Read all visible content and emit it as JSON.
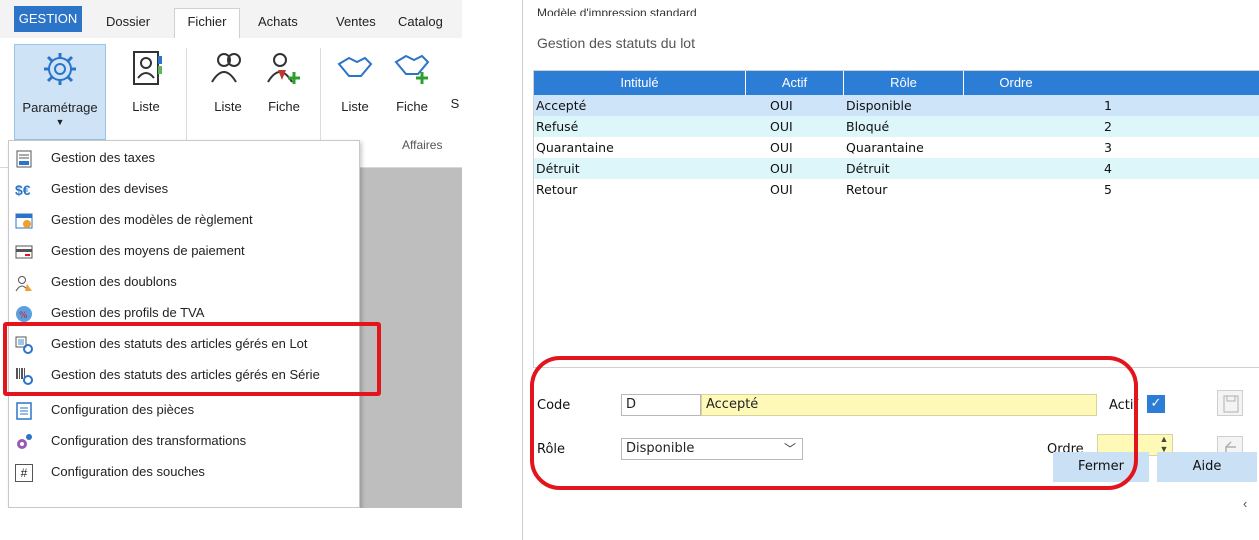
{
  "left": {
    "tabs": [
      "GESTION",
      "Dossier",
      "Fichier",
      "Achats",
      "Ventes",
      "Catalog"
    ],
    "ribbon": {
      "parametrage": "Paramétrage",
      "liste1": "Liste",
      "liste2": "Liste",
      "fiche1": "Fiche",
      "liste3": "Liste",
      "fiche2": "Fiche",
      "cut": "S",
      "group_affaires": "Affaires"
    },
    "menu": [
      {
        "label": "Gestion des taxes",
        "icon": "tax-doc-icon"
      },
      {
        "label": "Gestion des devises",
        "icon": "currency-icon"
      },
      {
        "label": "Gestion des modèles de règlement",
        "icon": "calendar-euro-icon"
      },
      {
        "label": "Gestion des moyens de paiement",
        "icon": "card-icon"
      },
      {
        "label": "Gestion des doublons",
        "icon": "duplicate-users-icon"
      },
      {
        "label": "Gestion des profils de TVA",
        "icon": "vat-globe-icon"
      },
      {
        "label": "Gestion des statuts des articles gérés en Lot",
        "icon": "lot-status-icon"
      },
      {
        "label": "Gestion des statuts des articles gérés en Série",
        "icon": "serial-status-icon"
      },
      {
        "label": "Configuration des pièces",
        "icon": "document-icon"
      },
      {
        "label": "Configuration des transformations",
        "icon": "gears-icon"
      },
      {
        "label": "Configuration des souches",
        "icon": "hash-icon"
      }
    ]
  },
  "dialog": {
    "top_cut_text": "Modèle d'impression   standard",
    "title": "Gestion des statuts du lot",
    "columns": [
      "Intitulé",
      "Actif",
      "Rôle",
      "Ordre"
    ],
    "rows": [
      {
        "intitule": "Accepté",
        "actif": "OUI",
        "role": "Disponible",
        "ordre": "1"
      },
      {
        "intitule": "Refusé",
        "actif": "OUI",
        "role": "Bloqué",
        "ordre": "2"
      },
      {
        "intitule": "Quarantaine",
        "actif": "OUI",
        "role": "Quarantaine",
        "ordre": "3"
      },
      {
        "intitule": "Détruit",
        "actif": "OUI",
        "role": "Détruit",
        "ordre": "4"
      },
      {
        "intitule": "Retour",
        "actif": "OUI",
        "role": "Retour",
        "ordre": "5"
      }
    ],
    "form": {
      "code_label": "Code",
      "code_value": "D",
      "intitule_value": "Accepté",
      "actif_label": "Actif",
      "actif_checked": true,
      "role_label": "Rôle",
      "role_value": "Disponible",
      "ordre_label": "Ordre",
      "ordre_value": ""
    },
    "buttons": {
      "fermer": "Fermer",
      "aide": "Aide"
    }
  },
  "colors": {
    "accent": "#2b7dd6",
    "highlight_red": "#e2141c",
    "selected_row": "#cde4f9",
    "alt_row": "#ddf6fa",
    "yellow_field": "#fff9b8"
  }
}
